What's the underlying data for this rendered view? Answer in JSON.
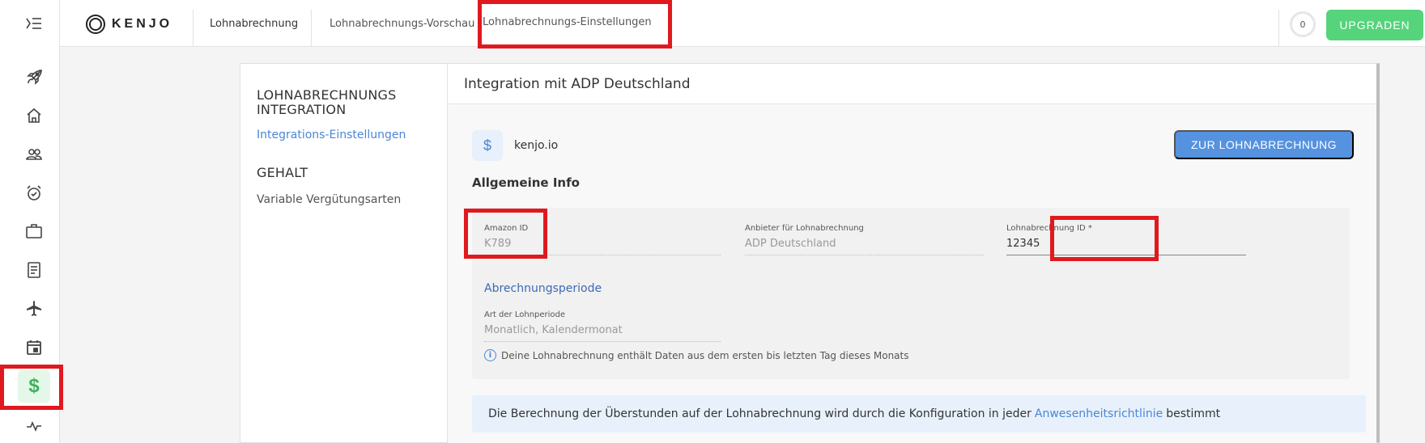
{
  "rail": {
    "items": [
      {
        "icon": "rocket-icon"
      },
      {
        "icon": "home-icon"
      },
      {
        "icon": "people-icon"
      },
      {
        "icon": "alarm-clock-icon"
      },
      {
        "icon": "briefcase-icon"
      },
      {
        "icon": "document-icon"
      },
      {
        "icon": "airplane-icon"
      },
      {
        "icon": "calendar-icon"
      },
      {
        "icon": "dollar-icon",
        "label": "$",
        "active": true
      },
      {
        "icon": "activity-icon"
      }
    ]
  },
  "topbar": {
    "logo_text": "KENJO",
    "tabs": [
      {
        "label": "Lohnabrechnung"
      },
      {
        "label": "Lohnabrechnungs-Vorschau"
      },
      {
        "label": "Lohnabrechnungs-Einstellungen",
        "active": true
      }
    ],
    "counter": "0",
    "upgrade_label": "UPGRADEN"
  },
  "subnav": {
    "section1_title": "LOHNABRECHNUNGS INTEGRATION",
    "section1_link": "Integrations-Einstellungen",
    "section2_title": "GEHALT",
    "section2_link": "Variable Vergütungsarten"
  },
  "content": {
    "header": "Integration mit ADP Deutschland",
    "brand_icon": "$",
    "brand_name": "kenjo.io",
    "cta_label": "ZUR LOHNABRECHNUNG",
    "section_title": "Allgemeine Info",
    "fields": {
      "amazon_id": {
        "label": "Amazon ID",
        "value": "K789"
      },
      "provider": {
        "label": "Anbieter für Lohnabrechnung",
        "value": "ADP Deutschland"
      },
      "payroll_id": {
        "label": "Lohnabrechnung ID *",
        "value": "12345"
      }
    },
    "period_title": "Abrechnungsperiode",
    "period_field": {
      "label": "Art der Lohnperiode",
      "value": "Monatlich, Kalendermonat"
    },
    "note_icon": "i",
    "note": "Deine Lohnabrechnung enthält Daten aus dem ersten bis letzten Tag dieses Monats",
    "banner_before": "Die Berechnung der Überstunden auf der Lohnabrechnung wird durch die Konfiguration in jeder",
    "banner_link": "Anwesenheitsrichtlinie",
    "banner_after": "bestimmt"
  },
  "colors": {
    "accent_green": "#55d47b",
    "accent_blue": "#5592e0",
    "highlight_red": "#e0191f"
  }
}
